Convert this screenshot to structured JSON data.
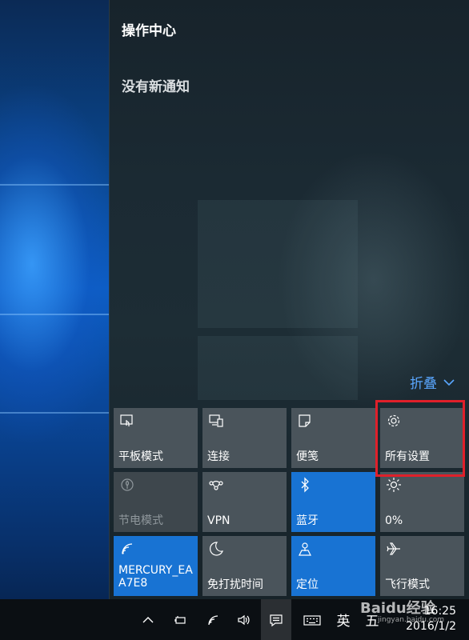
{
  "action_center": {
    "title": "操作中心",
    "no_notifications": "没有新通知",
    "collapse_label": "折叠"
  },
  "tiles": [
    {
      "label": "平板模式",
      "icon": "tablet-mode-icon",
      "state": "off"
    },
    {
      "label": "连接",
      "icon": "connect-icon",
      "state": "off"
    },
    {
      "label": "便笺",
      "icon": "note-icon",
      "state": "off"
    },
    {
      "label": "所有设置",
      "icon": "gear-icon",
      "state": "off"
    },
    {
      "label": "节电模式",
      "icon": "battery-saver-icon",
      "state": "disabled"
    },
    {
      "label": "VPN",
      "icon": "vpn-icon",
      "state": "off"
    },
    {
      "label": "蓝牙",
      "icon": "bluetooth-icon",
      "state": "on"
    },
    {
      "label": "0%",
      "icon": "brightness-icon",
      "state": "off"
    },
    {
      "label": "MERCURY_EA\nA7E8",
      "label_line1": "MERCURY_EA",
      "label_line2": "A7E8",
      "icon": "wifi-icon",
      "state": "on"
    },
    {
      "label": "免打扰时间",
      "icon": "moon-icon",
      "state": "off"
    },
    {
      "label": "定位",
      "icon": "location-icon",
      "state": "on"
    },
    {
      "label": "飞行模式",
      "icon": "airplane-icon",
      "state": "off"
    }
  ],
  "taskbar": {
    "ime_language": "英",
    "ime_mode": "五",
    "time": "16:25",
    "date": "2016/1/2"
  },
  "watermark": {
    "brand": "Baidu经验",
    "url": "jingyan.baidu.com"
  },
  "colors": {
    "accent": "#1873d3",
    "tile_off": "#4a545b",
    "highlight": "#e0202a",
    "link": "#5aa7ff"
  }
}
